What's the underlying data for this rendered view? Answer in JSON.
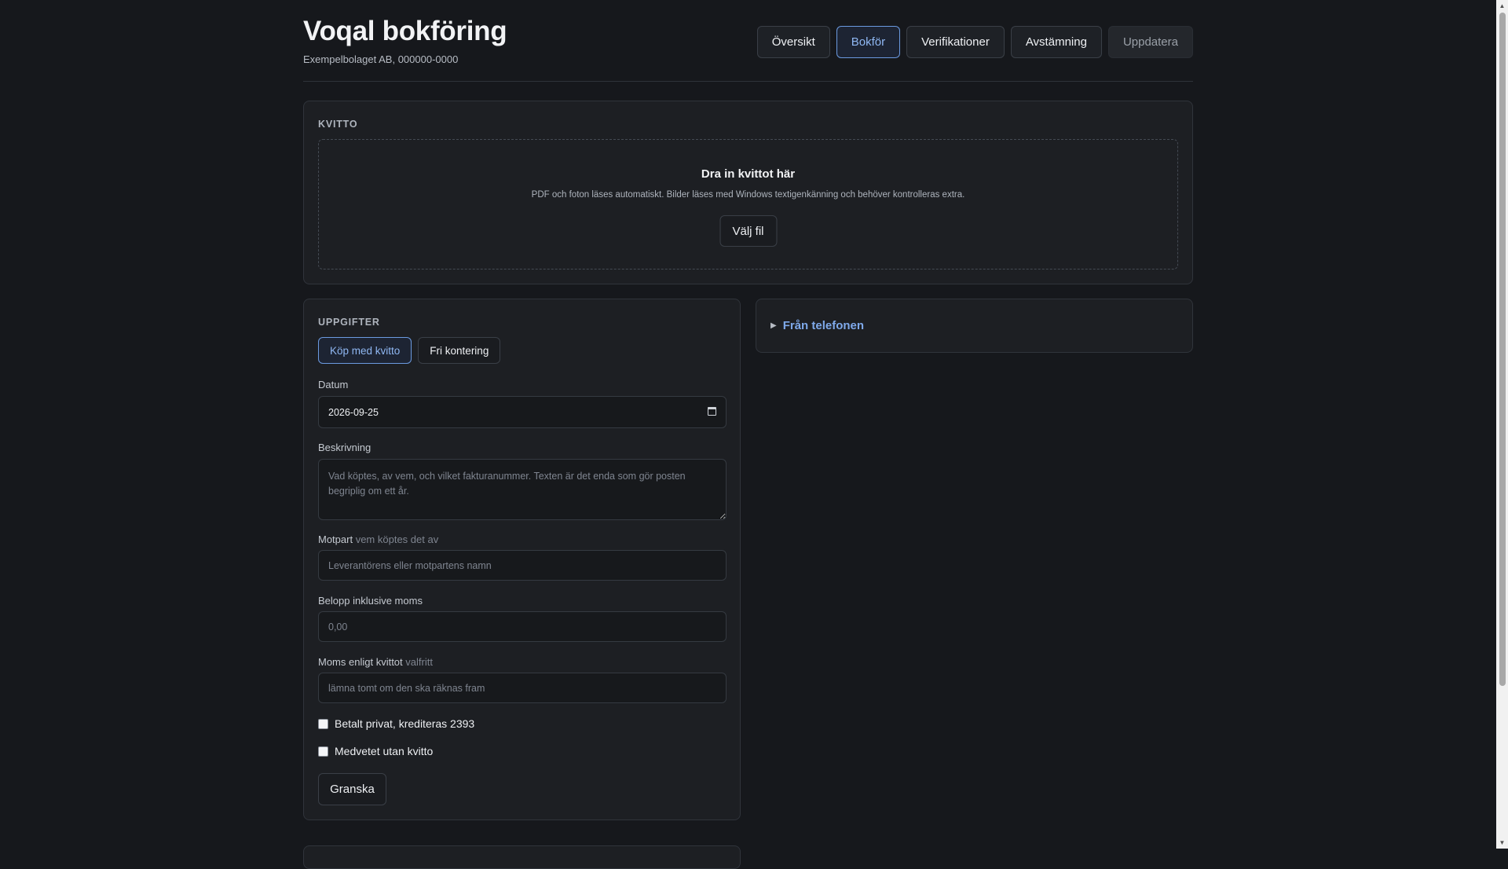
{
  "header": {
    "title": "Voqal bokföring",
    "company": "Exempelbolaget AB, 000000-0000",
    "nav": [
      "Översikt",
      "Bokför",
      "Verifikationer",
      "Avstämning",
      "Uppdatera"
    ],
    "active_nav": "Bokför"
  },
  "receipt": {
    "section_label": "KVITTO",
    "drop_title": "Dra in kvittot här",
    "drop_hint": "PDF och foton läses automatiskt. Bilder läses med Windows textigenkänning och behöver kontrolleras extra.",
    "choose_file_label": "Välj fil"
  },
  "tasks": {
    "section_label": "UPPGIFTER",
    "tabs": [
      "Köp med kvitto",
      "Fri kontering"
    ],
    "active_tab": "Köp med kvitto",
    "date_label": "Datum",
    "date_value": "2026-09-25",
    "description_label": "Beskrivning",
    "description_placeholder": "Vad köptes, av vem, och vilket fakturanummer. Texten är det enda som gör posten begriplig om ett år.",
    "counterparty_label": "Motpart",
    "counterparty_hint": "vem köptes det av",
    "counterparty_placeholder": "Leverantörens eller motpartens namn",
    "amount_label": "Belopp inklusive moms",
    "amount_placeholder": "0,00",
    "vat_label": "Moms enligt kvittot",
    "vat_hint": "valfritt",
    "vat_placeholder": "lämna tomt om den ska räknas fram",
    "paid_private_label": "Betalt privat, krediteras 2393",
    "paid_private_checked": false,
    "no_receipt_label": "Medvetet utan kvitto",
    "no_receipt_checked": false,
    "review_label": "Granska"
  },
  "phone": {
    "summary_label": "Från telefonen"
  },
  "colors": {
    "background": "#16181c",
    "panel": "#1d1f23",
    "accent": "#7fa9ea",
    "border": "#30343b"
  }
}
